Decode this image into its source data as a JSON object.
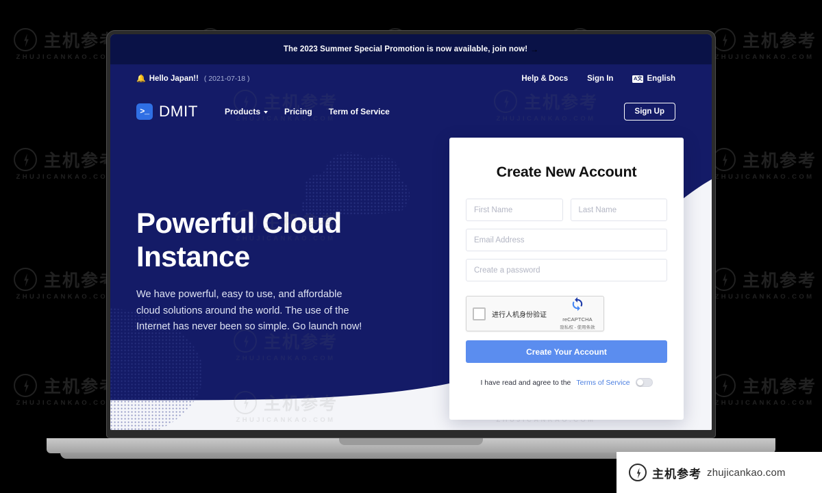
{
  "announcement": {
    "text": "The 2023 Summer Special Promotion is now available, join now!",
    "arrow": "→"
  },
  "utility_bar": {
    "bell_icon": "bell-icon",
    "greeting": "Hello Japan!!",
    "date": "( 2021-07-18 )",
    "links": [
      {
        "label": "Help & Docs"
      },
      {
        "label": "Sign In"
      }
    ],
    "language": {
      "icon": "translate-icon",
      "icon_glyphs": [
        "A",
        "文"
      ],
      "label": "English"
    }
  },
  "navbar": {
    "logo": {
      "icon": "terminal-prompt-icon",
      "glyph": ">_",
      "name": "DMIT"
    },
    "links": [
      {
        "label": "Products",
        "has_caret": true
      },
      {
        "label": "Pricing",
        "has_caret": false
      },
      {
        "label": "Term of Service",
        "has_caret": false
      }
    ],
    "signup_label": "Sign Up"
  },
  "hero": {
    "title_line1": "Powerful Cloud",
    "title_line2": "Instance",
    "subtitle": "We have powerful, easy to use, and affordable cloud solutions around the world. The use of the Internet has never been so simple. Go launch now!"
  },
  "signup_card": {
    "title": "Create New Account",
    "fields": {
      "first_name": {
        "placeholder": "First Name",
        "value": ""
      },
      "last_name": {
        "placeholder": "Last Name",
        "value": ""
      },
      "email": {
        "placeholder": "Email Address",
        "value": ""
      },
      "password": {
        "placeholder": "Create a password",
        "value": ""
      }
    },
    "captcha": {
      "label": "进行人机身份验证",
      "brand": "reCAPTCHA",
      "terms": "隐私权 - 使用条款",
      "checked": false
    },
    "submit_label": "Create Your Account",
    "agreement": {
      "text": "I have read and agree to the",
      "link_label": "Terms of Service",
      "toggle_on": false
    }
  },
  "watermark": {
    "cn": "主机参考",
    "en": "ZHUJICANKAO.COM",
    "icon": "lightning-circle-icon"
  },
  "badge": {
    "cn": "主机参考",
    "url": "zhujicankao.com",
    "icon": "lightning-circle-icon"
  },
  "colors": {
    "announce_bg": "#0a1247",
    "hero_navy": "#141b67",
    "accent_blue": "#5b8def",
    "logo_blue": "#2f6fe4",
    "link_blue": "#4a7ee0",
    "page_bg": "#f4f5f9"
  }
}
